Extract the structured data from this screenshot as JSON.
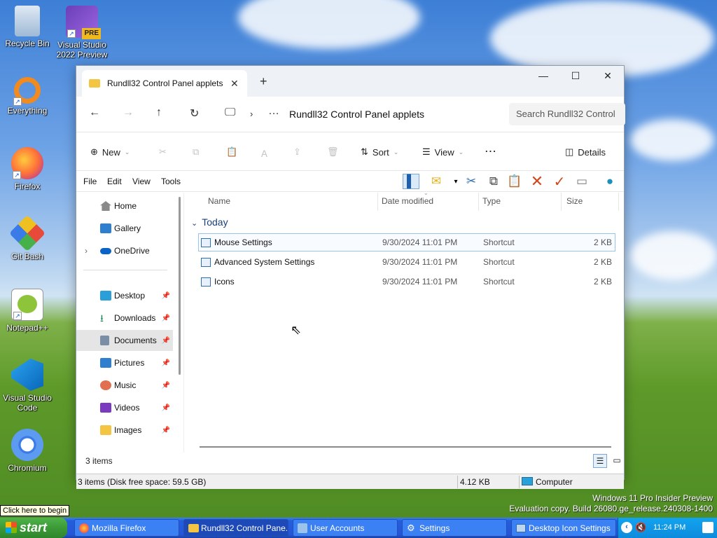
{
  "desktop": {
    "icons": [
      {
        "label": "Recycle Bin",
        "icon": "recycle-bin-icon"
      },
      {
        "label": "Visual Studio 2022 Preview",
        "badge": "PRE",
        "icon": "visual-studio-icon"
      },
      {
        "label": "Everything",
        "icon": "everything-search-icon"
      },
      {
        "label": "Firefox",
        "icon": "firefox-icon"
      },
      {
        "label": "Git Bash",
        "icon": "git-bash-icon"
      },
      {
        "label": "Notepad++",
        "icon": "notepad-plus-plus-icon"
      },
      {
        "label": "Visual Studio Code",
        "icon": "vscode-icon"
      },
      {
        "label": "Chromium",
        "icon": "chromium-icon"
      }
    ],
    "watermark_line1": "Windows 11 Pro Insider Preview",
    "watermark_line2": "Evaluation copy. Build 26080.ge_release.240308-1400",
    "tooltip": "Click here to begin"
  },
  "explorer": {
    "tab_title": "Rundll32 Control Panel applets",
    "address_path": "Rundll32 Control Panel applets",
    "search_placeholder": "Search Rundll32 Control",
    "commands": {
      "new": "New",
      "sort": "Sort",
      "view": "View",
      "more": "...",
      "details": "Details"
    },
    "menu": [
      "File",
      "Edit",
      "View",
      "Tools"
    ],
    "sidebar": [
      {
        "label": "Home",
        "icon": "home-icon"
      },
      {
        "label": "Gallery",
        "icon": "gallery-icon"
      },
      {
        "label": "OneDrive",
        "icon": "onedrive-icon"
      },
      {
        "label": "Desktop",
        "icon": "desktop-folder-icon"
      },
      {
        "label": "Downloads",
        "icon": "downloads-icon"
      },
      {
        "label": "Documents",
        "icon": "documents-icon"
      },
      {
        "label": "Pictures",
        "icon": "pictures-icon"
      },
      {
        "label": "Music",
        "icon": "music-icon"
      },
      {
        "label": "Videos",
        "icon": "videos-icon"
      },
      {
        "label": "Images",
        "icon": "folder-icon"
      }
    ],
    "columns": {
      "name": "Name",
      "date": "Date modified",
      "type": "Type",
      "size": "Size"
    },
    "group_label": "Today",
    "files": [
      {
        "name": "Mouse Settings",
        "date": "9/30/2024 11:01 PM",
        "type": "Shortcut",
        "size": "2 KB"
      },
      {
        "name": "Advanced System Settings",
        "date": "9/30/2024 11:01 PM",
        "type": "Shortcut",
        "size": "2 KB"
      },
      {
        "name": "Icons",
        "date": "9/30/2024 11:01 PM",
        "type": "Shortcut",
        "size": "2 KB"
      }
    ],
    "item_count": "3 items",
    "status_left": "3 items (Disk free space: 59.5 GB)",
    "status_size": "4.12 KB",
    "status_location": "Computer"
  },
  "taskbar": {
    "start_label": "start",
    "buttons": [
      {
        "label": "Mozilla Firefox",
        "icon": "firefox-icon"
      },
      {
        "label": "Rundll32 Control Pane...",
        "icon": "folder-icon"
      },
      {
        "label": "User Accounts",
        "icon": "user-accounts-icon"
      },
      {
        "label": "Settings",
        "icon": "gear-icon"
      },
      {
        "label": "Desktop Icon Settings",
        "icon": "desktop-icon-settings-icon"
      }
    ],
    "clock": "11:24 PM"
  },
  "colors": {
    "accent": "#245edb",
    "start_green": "#3c9a37",
    "selection": "#99c4ec"
  }
}
